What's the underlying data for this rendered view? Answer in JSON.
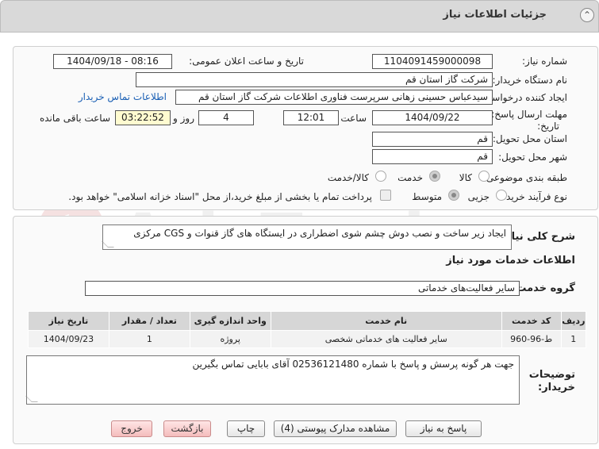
{
  "header": {
    "title": "جزئیات اطلاعات نیاز"
  },
  "fields": {
    "need_number_label": "شماره نیاز:",
    "need_number": "1104091459000098",
    "announce_datetime_label": "تاریخ و ساعت اعلان عمومی:",
    "announce_datetime": "1404/09/18 - 08:16",
    "buyer_org_label": "نام دستگاه خریدار:",
    "buyer_org": "شرکت گاز استان قم",
    "requester_label": "ایجاد کننده درخواست:",
    "requester": "سیدعباس حسینی زهانی سرپرست فناوری اطلاعات شرکت گاز استان قم",
    "contact_link": "اطلاعات تماس خریدار",
    "deadline_label_1": "مهلت ارسال پاسخ: تا",
    "deadline_label_2": "تاریخ:",
    "deadline_date": "1404/09/22",
    "time_label": "ساعت",
    "deadline_time": "12:01",
    "days_count": "4",
    "days_label": "روز و",
    "remaining_time": "03:22:52",
    "remaining_label": "ساعت باقی مانده",
    "province_label": "استان محل تحویل:",
    "province": "قم",
    "city_label": "شهر محل تحویل:",
    "city": "قم",
    "category_label": "طبقه بندی موضوعی:",
    "category_options": [
      "کالا",
      "خدمت",
      "کالا/خدمت"
    ],
    "category_selected": "خدمت",
    "process_label": "نوع فرآیند خرید :",
    "process_options": [
      "جزیی",
      "متوسط"
    ],
    "process_selected": "متوسط",
    "payment_note": "پرداخت تمام یا بخشی از مبلغ خرید،از محل \"اسناد خزانه اسلامی\" خواهد بود."
  },
  "general_description": {
    "label": "شرح کلی نیاز:",
    "text": "ایجاد زیر ساخت و نصب دوش چشم شوی اضطراری در ایستگاه های گاز قنوات و CGS مرکزی"
  },
  "services": {
    "section_title": "اطلاعات خدمات مورد نیاز",
    "group_label": "گروه خدمت:",
    "group_value": "سایر فعالیت‌های خدماتی",
    "columns": [
      "ردیف",
      "کد خدمت",
      "نام خدمت",
      "واحد اندازه گیری",
      "تعداد / مقدار",
      "تاریخ نیاز"
    ],
    "rows": [
      [
        "1",
        "ط-96-960",
        "سایر فعالیت های خدماتی شخصی",
        "پروژه",
        "1",
        "1404/09/23"
      ]
    ]
  },
  "buyer_notes": {
    "label_1": "توضیحات",
    "label_2": "خریدار:",
    "text": "جهت هر گونه پرسش و پاسخ با شماره 02536121480 آقای بابایی تماس بگیرین"
  },
  "buttons": {
    "respond": "پاسخ به نیاز",
    "view_docs": "مشاهده مدارک پیوستی (4)",
    "print": "چاپ",
    "back": "بازگشت",
    "exit": "خروج"
  },
  "colors": {
    "header_bg": "#d9d9d9",
    "link": "#1a5fb4",
    "remaining_bg": "#fffbd0",
    "exit_button": "#f4bcbc"
  }
}
